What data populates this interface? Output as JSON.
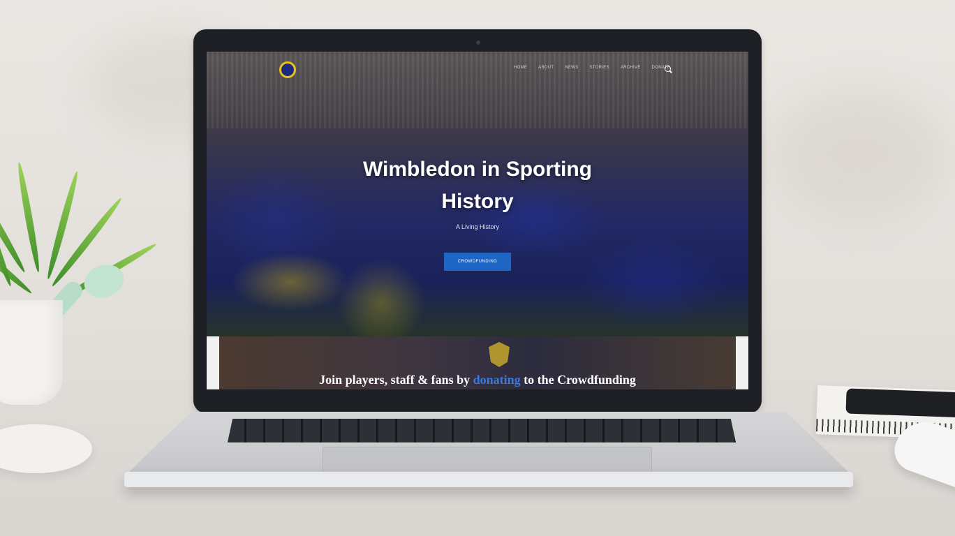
{
  "site": {
    "nav": [
      "HOME",
      "ABOUT",
      "NEWS",
      "STORIES",
      "ARCHIVE",
      "DONATE"
    ],
    "hero": {
      "title_line1": "Wimbledon in Sporting",
      "title_line2": "History",
      "subtitle": "A Living History",
      "button_label": "CROWDFUNDING"
    },
    "banner": {
      "text_before": "Join players, staff & fans by ",
      "link_text": "donating",
      "text_after": " to the Crowdfunding"
    }
  },
  "colors": {
    "accent_blue": "#1f66c4",
    "link_blue": "#3a7ae0",
    "club_yellow": "#e9c21f",
    "club_navy": "#1b2a7a"
  },
  "icons": [
    "club-crest-icon",
    "search-icon",
    "badge-icon"
  ]
}
